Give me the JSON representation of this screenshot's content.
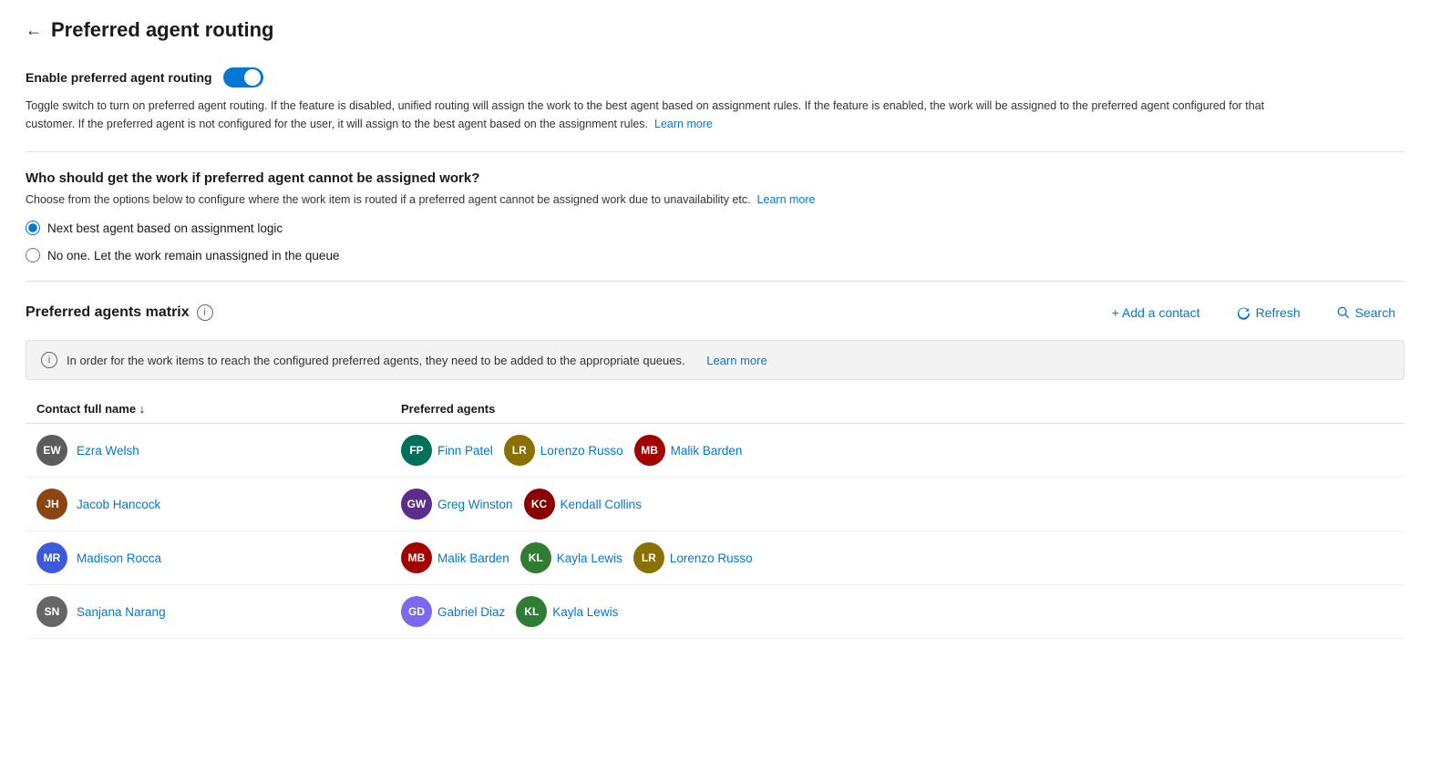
{
  "page": {
    "title": "Preferred agent routing",
    "back_label": "←"
  },
  "enable_section": {
    "label": "Enable preferred agent routing",
    "toggle_on": true,
    "description": "Toggle switch to turn on preferred agent routing. If the feature is disabled, unified routing will assign the work to the best agent based on assignment rules. If the feature is enabled, the work will be assigned to the preferred agent configured for that customer. If the preferred agent is not configured for the user, it will assign to the best agent based on the assignment rules.",
    "learn_more": "Learn more"
  },
  "fallback_section": {
    "title": "Who should get the work if preferred agent cannot be assigned work?",
    "description": "Choose from the options below to configure where the work item is routed if a preferred agent cannot be assigned work due to unavailability etc.",
    "learn_more": "Learn more",
    "options": [
      {
        "id": "opt1",
        "label": "Next best agent based on assignment logic",
        "selected": true
      },
      {
        "id": "opt2",
        "label": "No one. Let the work remain unassigned in the queue",
        "selected": false
      }
    ]
  },
  "matrix_section": {
    "title": "Preferred agents matrix",
    "info": "i",
    "actions": {
      "add_contact": "+ Add a contact",
      "refresh": "Refresh",
      "search": "Search"
    },
    "notice": "In order for the work items to reach the configured preferred agents, they need to be added to the appropriate queues.",
    "notice_learn_more": "Learn more",
    "table": {
      "columns": [
        "Contact full name ↓",
        "Preferred agents"
      ],
      "rows": [
        {
          "contact": {
            "initials": "EW",
            "name": "Ezra Welsh",
            "color": "#5c5c5c"
          },
          "agents": [
            {
              "initials": "FP",
              "name": "Finn Patel",
              "color": "#006f5c"
            },
            {
              "initials": "LR",
              "name": "Lorenzo Russo",
              "color": "#8a7000"
            },
            {
              "initials": "MB",
              "name": "Malik Barden",
              "color": "#a30000"
            }
          ]
        },
        {
          "contact": {
            "initials": "JH",
            "name": "Jacob Hancock",
            "color": "#8b4513"
          },
          "agents": [
            {
              "initials": "GW",
              "name": "Greg Winston",
              "color": "#5b2d8e"
            },
            {
              "initials": "KC",
              "name": "Kendall Collins",
              "color": "#8b0000"
            }
          ]
        },
        {
          "contact": {
            "initials": "MR",
            "name": "Madison Rocca",
            "color": "#3b5bdb"
          },
          "agents": [
            {
              "initials": "MB",
              "name": "Malik Barden",
              "color": "#a30000"
            },
            {
              "initials": "KL",
              "name": "Kayla Lewis",
              "color": "#2e7d32"
            },
            {
              "initials": "LR",
              "name": "Lorenzo Russo",
              "color": "#8a7000"
            }
          ]
        },
        {
          "contact": {
            "initials": "SN",
            "name": "Sanjana Narang",
            "color": "#666"
          },
          "agents": [
            {
              "initials": "GD",
              "name": "Gabriel Diaz",
              "color": "#7b68ee"
            },
            {
              "initials": "KL",
              "name": "Kayla Lewis",
              "color": "#2e7d32"
            }
          ]
        }
      ]
    }
  }
}
